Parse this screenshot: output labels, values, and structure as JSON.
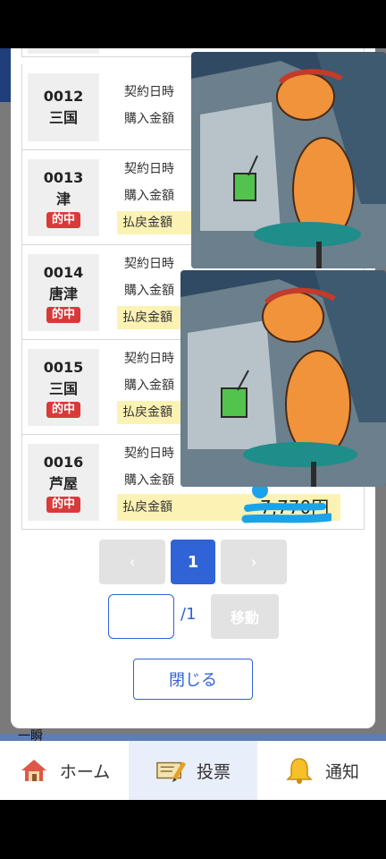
{
  "modal": {
    "rows": [
      {
        "num": "0012",
        "place": "三国",
        "hit": "",
        "labels": [
          "契約日時",
          "購入金額"
        ],
        "amount": ""
      },
      {
        "num": "0013",
        "place": "津",
        "hit": "的中",
        "labels": [
          "契約日時",
          "購入金額",
          "払戻金額"
        ],
        "amount": ""
      },
      {
        "num": "0014",
        "place": "唐津",
        "hit": "的中",
        "labels": [
          "契約日時",
          "購入金額",
          "払戻金額"
        ],
        "amount": ""
      },
      {
        "num": "0015",
        "place": "三国",
        "hit": "的中",
        "labels": [
          "契約日時",
          "購入金額",
          "払戻金額"
        ],
        "amount": ""
      },
      {
        "num": "0016",
        "place": "芦屋",
        "hit": "的中",
        "labels": [
          "契約日時",
          "購入金額",
          "払戻金額"
        ],
        "amount": "7,770円"
      }
    ],
    "pager": {
      "prev": "‹",
      "current": "1",
      "next": "›"
    },
    "jump": {
      "value": "",
      "placeholder": "",
      "total": "/1",
      "move_label": "移動"
    },
    "close_label": "閉じる"
  },
  "background": {
    "peek_text": "一瞬"
  },
  "nav": {
    "items": [
      {
        "label": "ホーム",
        "icon": "home-icon",
        "active": false
      },
      {
        "label": "投票",
        "icon": "ticket-pencil-icon",
        "active": true
      },
      {
        "label": "通知",
        "icon": "bell-icon",
        "active": false
      }
    ]
  },
  "colors": {
    "accent": "#2f63d6",
    "hit_badge": "#d83a3a",
    "highlight": "#fcf2b4",
    "nav_active": "#e9eefb"
  }
}
